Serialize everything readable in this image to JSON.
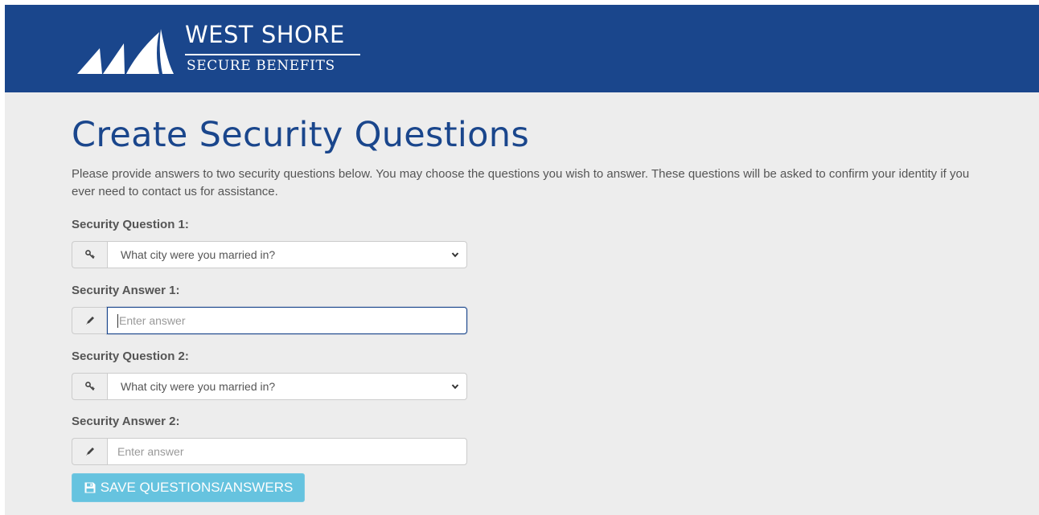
{
  "brand": {
    "line1": "WEST SHORE",
    "line2": "SECURE BENEFITS",
    "header_color": "#1a468c"
  },
  "page": {
    "title": "Create Security Questions",
    "intro": "Please provide answers to two security questions below. You may choose the questions you wish to answer. These questions will be asked to confirm your identity if you ever need to contact us for assistance."
  },
  "form": {
    "question1_label": "Security Question 1:",
    "question1_value": "What city were you married in?",
    "question1_icon": "key-icon",
    "answer1_label": "Security Answer 1:",
    "answer1_value": "",
    "answer1_placeholder": "Enter answer",
    "answer1_icon": "pencil-icon",
    "question2_label": "Security Question 2:",
    "question2_value": "What city were you married in?",
    "question2_icon": "key-icon",
    "answer2_label": "Security Answer 2:",
    "answer2_value": "",
    "answer2_placeholder": "Enter answer",
    "answer2_icon": "pencil-icon",
    "save_label": "SAVE QUESTIONS/ANSWERS",
    "save_icon": "floppy-disk-icon",
    "save_color": "#5bc0de"
  }
}
